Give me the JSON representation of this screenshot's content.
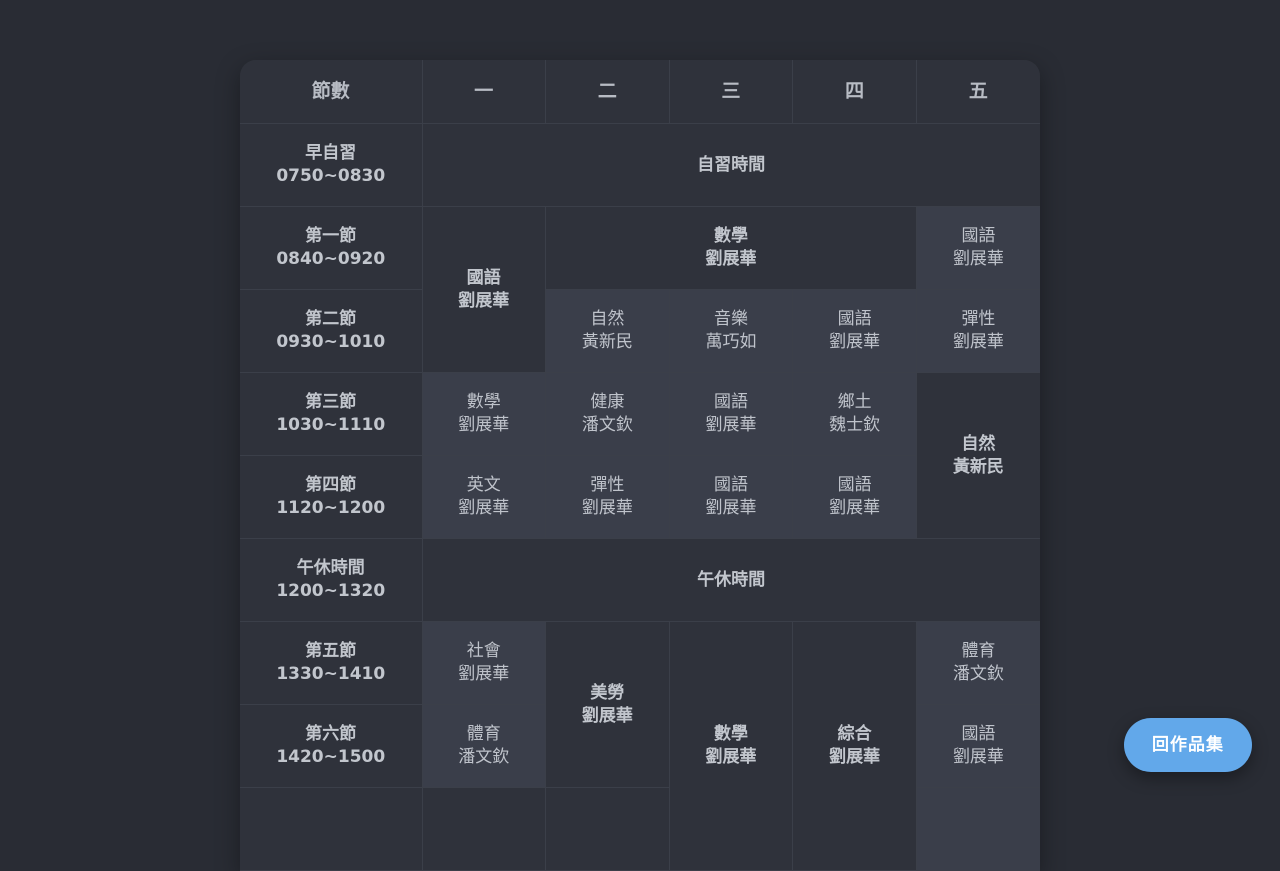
{
  "header": [
    "節數",
    "一",
    "二",
    "三",
    "四",
    "五"
  ],
  "periods": [
    {
      "name": "早自習",
      "time": "0750~0830"
    },
    {
      "name": "第一節",
      "time": "0840~0920"
    },
    {
      "name": "第二節",
      "time": "0930~1010"
    },
    {
      "name": "第三節",
      "time": "1030~1110"
    },
    {
      "name": "第四節",
      "time": "1120~1200"
    },
    {
      "name": "午休時間",
      "time": "1200~1320"
    },
    {
      "name": "第五節",
      "time": "1330~1410"
    },
    {
      "name": "第六節",
      "time": "1420~1500"
    }
  ],
  "cells": {
    "morning": "自習時間",
    "mon_12": {
      "subject": "國語",
      "teacher": "劉展華"
    },
    "tue_thu_1": {
      "subject": "數學",
      "teacher": "劉展華"
    },
    "fri_1": {
      "subject": "國語",
      "teacher": "劉展華"
    },
    "tue_2": {
      "subject": "自然",
      "teacher": "黃新民"
    },
    "wed_2": {
      "subject": "音樂",
      "teacher": "萬巧如"
    },
    "thu_2": {
      "subject": "國語",
      "teacher": "劉展華"
    },
    "fri_2": {
      "subject": "彈性",
      "teacher": "劉展華"
    },
    "mon_3": {
      "subject": "數學",
      "teacher": "劉展華"
    },
    "tue_3": {
      "subject": "健康",
      "teacher": "潘文欽"
    },
    "wed_3": {
      "subject": "國語",
      "teacher": "劉展華"
    },
    "thu_3": {
      "subject": "鄉土",
      "teacher": "魏士欽"
    },
    "fri_34": {
      "subject": "自然",
      "teacher": "黃新民"
    },
    "mon_4": {
      "subject": "英文",
      "teacher": "劉展華"
    },
    "tue_4": {
      "subject": "彈性",
      "teacher": "劉展華"
    },
    "wed_4": {
      "subject": "國語",
      "teacher": "劉展華"
    },
    "thu_4": {
      "subject": "國語",
      "teacher": "劉展華"
    },
    "lunch": "午休時間",
    "mon_5": {
      "subject": "社會",
      "teacher": "劉展華"
    },
    "tue_56": {
      "subject": "美勞",
      "teacher": "劉展華"
    },
    "wed_56": {
      "subject": "數學",
      "teacher": "劉展華"
    },
    "thu_56": {
      "subject": "綜合",
      "teacher": "劉展華"
    },
    "fri_5": {
      "subject": "體育",
      "teacher": "潘文欽"
    },
    "mon_6": {
      "subject": "體育",
      "teacher": "潘文欽"
    },
    "fri_6": {
      "subject": "國語",
      "teacher": "劉展華"
    }
  },
  "back_button": "回作品集",
  "colors": {
    "background": "#292c34",
    "table": "#30333c",
    "single_cell": "#3a3e4a",
    "accent": "#62a8ea"
  }
}
